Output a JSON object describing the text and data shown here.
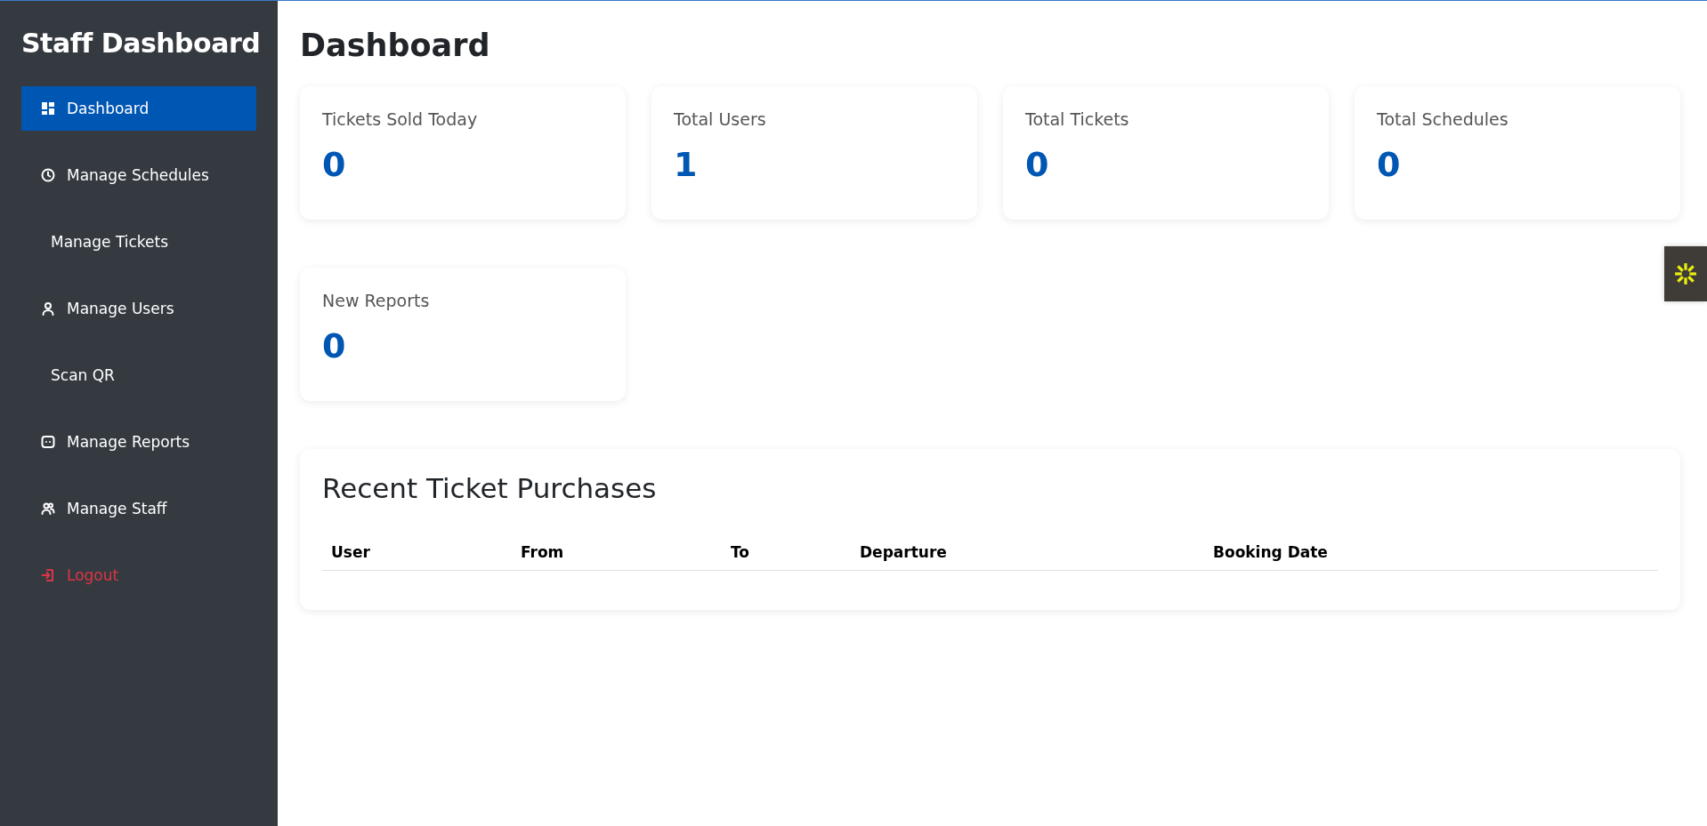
{
  "sidebar": {
    "title": "Staff Dashboard",
    "items": [
      {
        "label": "Dashboard",
        "kind": "grid",
        "selected": true
      },
      {
        "label": "Manage Schedules",
        "kind": "clock",
        "selected": false
      },
      {
        "label": "Manage Tickets",
        "kind": "plain",
        "selected": false
      },
      {
        "label": "Manage Users",
        "kind": "person",
        "selected": false
      },
      {
        "label": "Scan QR",
        "kind": "plain",
        "selected": false
      },
      {
        "label": "Manage Reports",
        "kind": "chat",
        "selected": false
      },
      {
        "label": "Manage Staff",
        "kind": "people",
        "selected": false
      },
      {
        "label": "Logout",
        "kind": "logout",
        "selected": false
      }
    ]
  },
  "page_title": "Dashboard",
  "stats": [
    {
      "label": "Tickets Sold Today",
      "value": "0"
    },
    {
      "label": "Total Users",
      "value": "1"
    },
    {
      "label": "Total Tickets",
      "value": "0"
    },
    {
      "label": "Total Schedules",
      "value": "0"
    },
    {
      "label": "New Reports",
      "value": "0"
    }
  ],
  "recent_purchases": {
    "title": "Recent Ticket Purchases",
    "columns": [
      "User",
      "From",
      "To",
      "Departure",
      "Booking Date"
    ]
  }
}
